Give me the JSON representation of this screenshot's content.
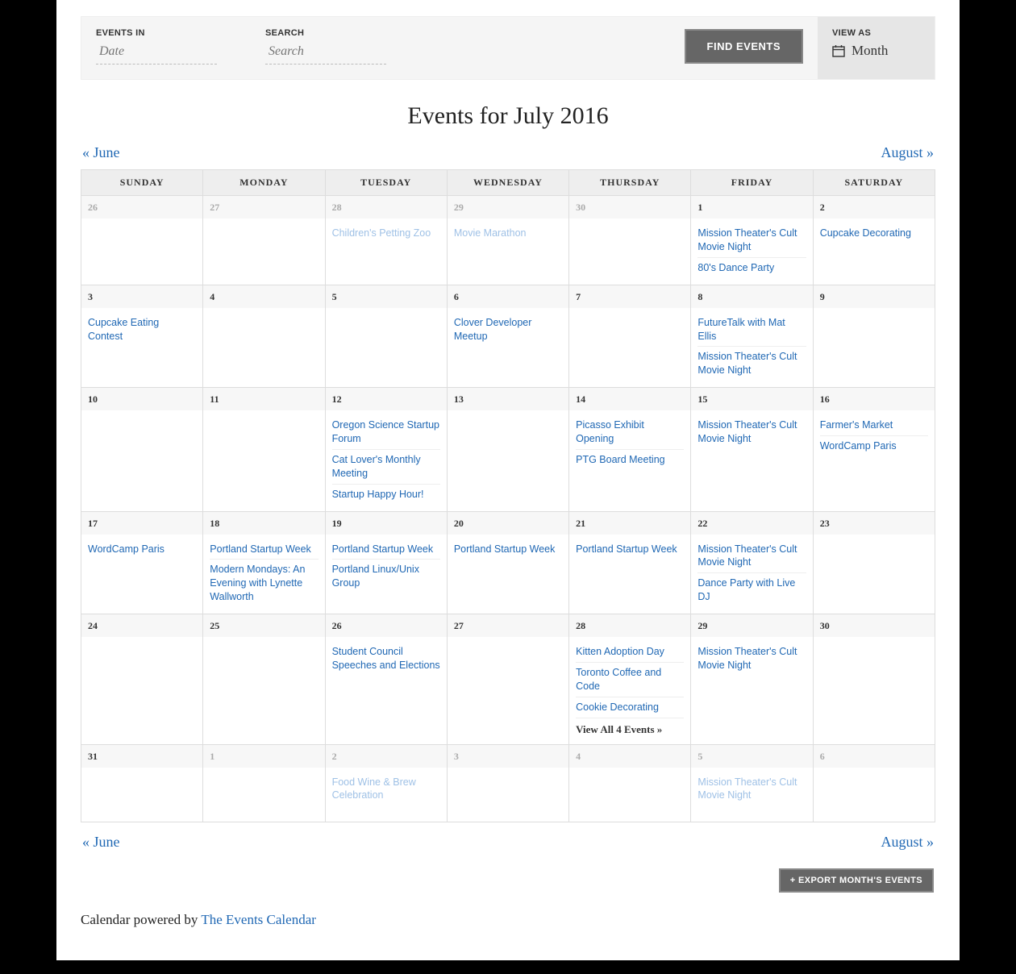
{
  "filters": {
    "events_in_label": "EVENTS IN",
    "date_placeholder": "Date",
    "search_label": "SEARCH",
    "search_placeholder": "Search",
    "find_button": "FIND EVENTS",
    "view_as_label": "VIEW AS",
    "view_as_value": "Month"
  },
  "title": "Events for July 2016",
  "prev_nav": "« June",
  "next_nav": "August »",
  "day_headers": [
    "SUNDAY",
    "MONDAY",
    "TUESDAY",
    "WEDNESDAY",
    "THURSDAY",
    "FRIDAY",
    "SATURDAY"
  ],
  "weeks": [
    [
      {
        "num": "26",
        "other": true,
        "events": []
      },
      {
        "num": "27",
        "other": true,
        "events": []
      },
      {
        "num": "28",
        "other": true,
        "events": [
          "Children's Petting Zoo"
        ]
      },
      {
        "num": "29",
        "other": true,
        "events": [
          "Movie Marathon"
        ]
      },
      {
        "num": "30",
        "other": true,
        "events": []
      },
      {
        "num": "1",
        "events": [
          "Mission Theater's Cult Movie Night",
          "80's Dance Party"
        ]
      },
      {
        "num": "2",
        "events": [
          "Cupcake Decorating"
        ]
      }
    ],
    [
      {
        "num": "3",
        "events": [
          "Cupcake Eating Contest"
        ]
      },
      {
        "num": "4",
        "events": []
      },
      {
        "num": "5",
        "events": []
      },
      {
        "num": "6",
        "events": [
          "Clover Developer Meetup"
        ]
      },
      {
        "num": "7",
        "events": []
      },
      {
        "num": "8",
        "events": [
          "FutureTalk with Mat Ellis",
          "Mission Theater's Cult Movie Night"
        ]
      },
      {
        "num": "9",
        "events": []
      }
    ],
    [
      {
        "num": "10",
        "events": []
      },
      {
        "num": "11",
        "events": []
      },
      {
        "num": "12",
        "events": [
          "Oregon Science Startup Forum",
          "Cat Lover's Monthly Meeting",
          "Startup Happy Hour!"
        ]
      },
      {
        "num": "13",
        "events": []
      },
      {
        "num": "14",
        "events": [
          "Picasso Exhibit Opening",
          "PTG Board Meeting"
        ]
      },
      {
        "num": "15",
        "events": [
          "Mission Theater's Cult Movie Night"
        ]
      },
      {
        "num": "16",
        "events": [
          "Farmer's Market",
          "WordCamp Paris"
        ]
      }
    ],
    [
      {
        "num": "17",
        "events": [
          "WordCamp Paris"
        ]
      },
      {
        "num": "18",
        "events": [
          "Portland Startup Week",
          "Modern Mondays: An Evening with Lynette Wallworth"
        ]
      },
      {
        "num": "19",
        "events": [
          "Portland Startup Week",
          "Portland Linux/Unix Group"
        ]
      },
      {
        "num": "20",
        "events": [
          "Portland Startup Week"
        ]
      },
      {
        "num": "21",
        "events": [
          "Portland Startup Week"
        ]
      },
      {
        "num": "22",
        "events": [
          "Mission Theater's Cult Movie Night",
          "Dance Party with Live DJ"
        ]
      },
      {
        "num": "23",
        "events": []
      }
    ],
    [
      {
        "num": "24",
        "events": []
      },
      {
        "num": "25",
        "events": []
      },
      {
        "num": "26",
        "events": [
          "Student Council Speeches and Elections"
        ]
      },
      {
        "num": "27",
        "events": []
      },
      {
        "num": "28",
        "events": [
          "Kitten Adoption Day",
          "Toronto Coffee and Code",
          "Cookie Decorating"
        ],
        "view_all": "View All 4 Events »"
      },
      {
        "num": "29",
        "events": [
          "Mission Theater's Cult Movie Night"
        ]
      },
      {
        "num": "30",
        "events": []
      }
    ],
    [
      {
        "num": "31",
        "events": []
      },
      {
        "num": "1",
        "other": true,
        "events": []
      },
      {
        "num": "2",
        "other": true,
        "events": [
          "Food Wine & Brew Celebration"
        ]
      },
      {
        "num": "3",
        "other": true,
        "events": []
      },
      {
        "num": "4",
        "other": true,
        "events": []
      },
      {
        "num": "5",
        "other": true,
        "events": [
          "Mission Theater's Cult Movie Night"
        ]
      },
      {
        "num": "6",
        "other": true,
        "events": []
      }
    ]
  ],
  "export_button": "+ EXPORT MONTH'S EVENTS",
  "powered_prefix": "Calendar powered by ",
  "powered_link": "The Events Calendar"
}
